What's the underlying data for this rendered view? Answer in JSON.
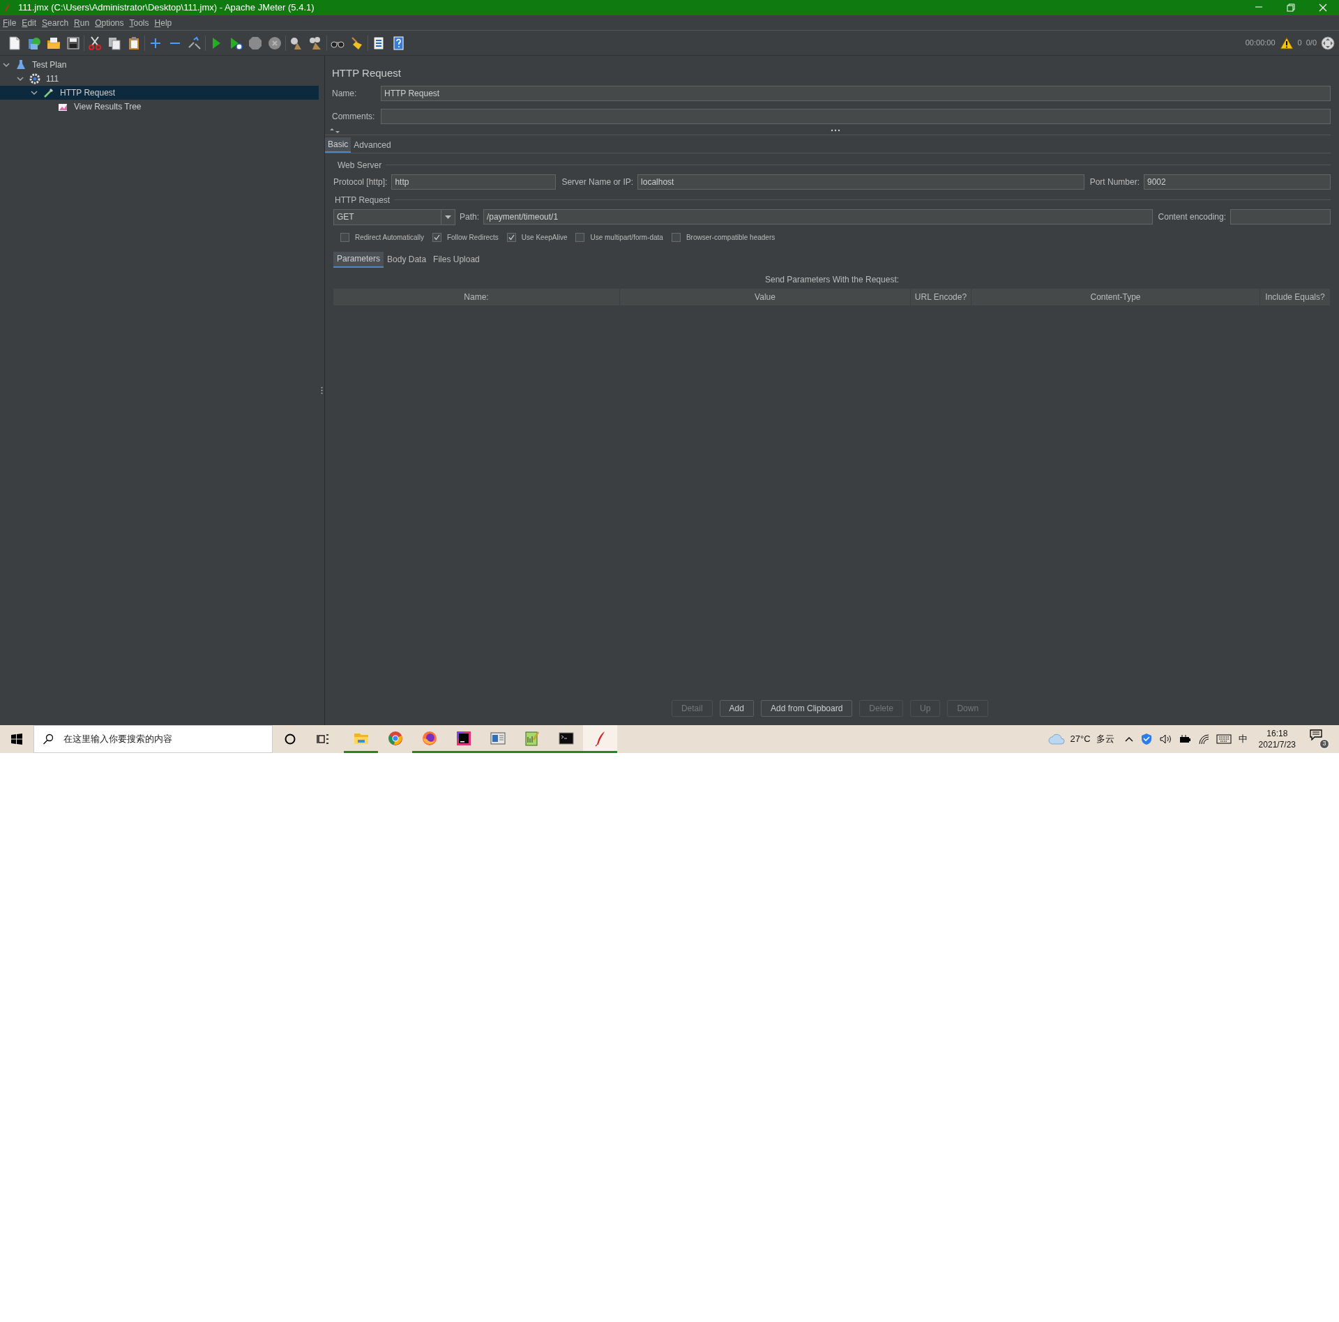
{
  "window": {
    "title": "111.jmx (C:\\Users\\Administrator\\Desktop\\111.jmx) - Apache JMeter (5.4.1)"
  },
  "menu": [
    "File",
    "Edit",
    "Search",
    "Run",
    "Options",
    "Tools",
    "Help"
  ],
  "toolbar_status": {
    "elapsed": "00:00:00",
    "errors": "0",
    "threads": "0/0"
  },
  "tree": [
    {
      "label": "Test Plan",
      "kind": "plan",
      "expanded": true,
      "selected": false,
      "children": [
        {
          "label": "111",
          "kind": "group",
          "expanded": true,
          "selected": false,
          "children": [
            {
              "label": "HTTP Request",
              "kind": "sampler",
              "expanded": true,
              "selected": true,
              "children": [
                {
                  "label": "View Results Tree",
                  "kind": "listener",
                  "selected": false
                }
              ]
            }
          ]
        }
      ]
    }
  ],
  "panel": {
    "title": "HTTP Request",
    "name": {
      "label": "Name:",
      "value": "HTTP Request"
    },
    "comments": {
      "label": "Comments:"
    },
    "tabs": [
      {
        "label": "Basic",
        "selected": true
      },
      {
        "label": "Advanced",
        "selected": false
      }
    ],
    "web_server": {
      "heading": "Web Server",
      "protocol_label": "Protocol [http]:",
      "protocol": "http",
      "server_label": "Server Name or IP:",
      "server": "localhost",
      "port_label": "Port Number:",
      "port": "9002"
    },
    "http_request": {
      "heading": "HTTP Request",
      "method": "GET",
      "path_label": "Path:",
      "path": "/payment/timeout/1",
      "encoding_label": "Content encoding:"
    },
    "options": [
      {
        "label": "Redirect Automatically",
        "checked": false
      },
      {
        "label": "Follow Redirects",
        "checked": true
      },
      {
        "label": "Use KeepAlive",
        "checked": true
      },
      {
        "label": "Use multipart/form-data",
        "checked": false
      },
      {
        "label": "Browser-compatible headers",
        "checked": false
      }
    ],
    "sub_tabs": [
      {
        "label": "Parameters",
        "selected": true
      },
      {
        "label": "Body Data",
        "selected": false
      },
      {
        "label": "Files Upload",
        "selected": false
      }
    ],
    "table": {
      "caption": "Send Parameters With the Request:",
      "columns": [
        "Name:",
        "Value",
        "URL Encode?",
        "Content-Type",
        "Include Equals?"
      ]
    },
    "buttons": [
      {
        "label": "Detail",
        "disabled": true
      },
      {
        "label": "Add",
        "disabled": false
      },
      {
        "label": "Add from Clipboard",
        "disabled": false
      },
      {
        "label": "Delete",
        "disabled": true
      },
      {
        "label": "Up",
        "disabled": true
      },
      {
        "label": "Down",
        "disabled": true
      }
    ]
  },
  "taskbar": {
    "search_placeholder": "在这里输入你要搜索的内容",
    "apps": [
      {
        "running": true,
        "selected": false
      },
      {
        "running": false,
        "selected": false
      },
      {
        "running": true,
        "selected": false
      },
      {
        "running": true,
        "selected": false
      },
      {
        "running": true,
        "selected": false
      },
      {
        "running": true,
        "selected": false
      },
      {
        "running": true,
        "selected": false
      },
      {
        "running": true,
        "selected": true
      }
    ],
    "weather": "27°C",
    "condition": "多云",
    "ime": "中",
    "time": "16:18",
    "date": "2021/7/23",
    "notifications": "3"
  }
}
